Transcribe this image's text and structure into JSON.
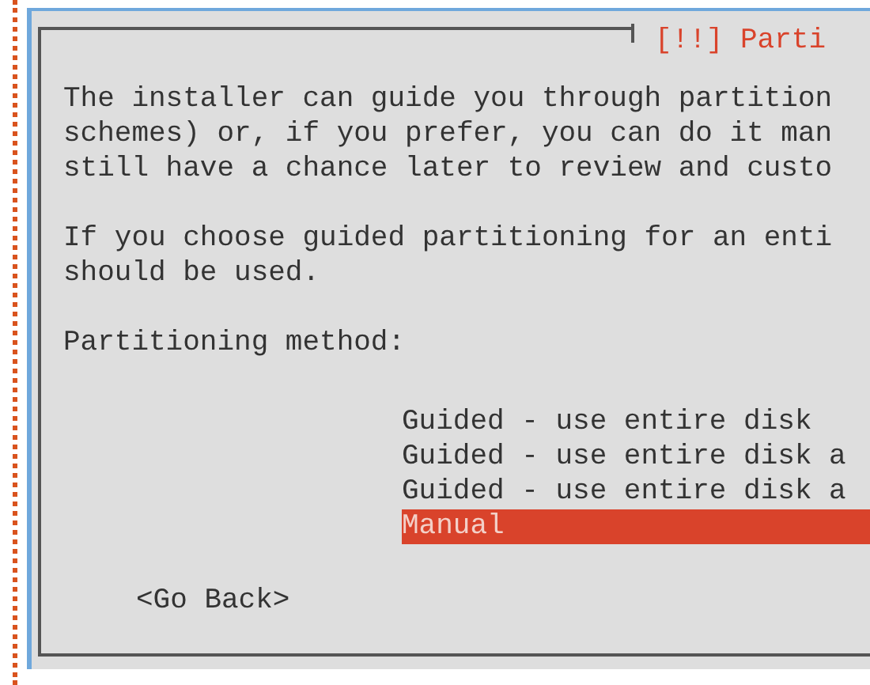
{
  "dialog": {
    "title": "[!!] Parti",
    "paragraphs": [
      [
        "The installer can guide you through partition",
        "schemes) or, if you prefer, you can do it man",
        "still have a chance later to review and custo"
      ],
      [
        "If you choose guided partitioning for an enti",
        "should be used."
      ]
    ],
    "prompt": "Partitioning method:",
    "options": [
      {
        "label": "Guided - use entire disk",
        "selected": false
      },
      {
        "label": "Guided - use entire disk a",
        "selected": false
      },
      {
        "label": "Guided - use entire disk a",
        "selected": false
      },
      {
        "label": "Manual",
        "selected": true
      }
    ],
    "back_button": "<Go Back>"
  }
}
